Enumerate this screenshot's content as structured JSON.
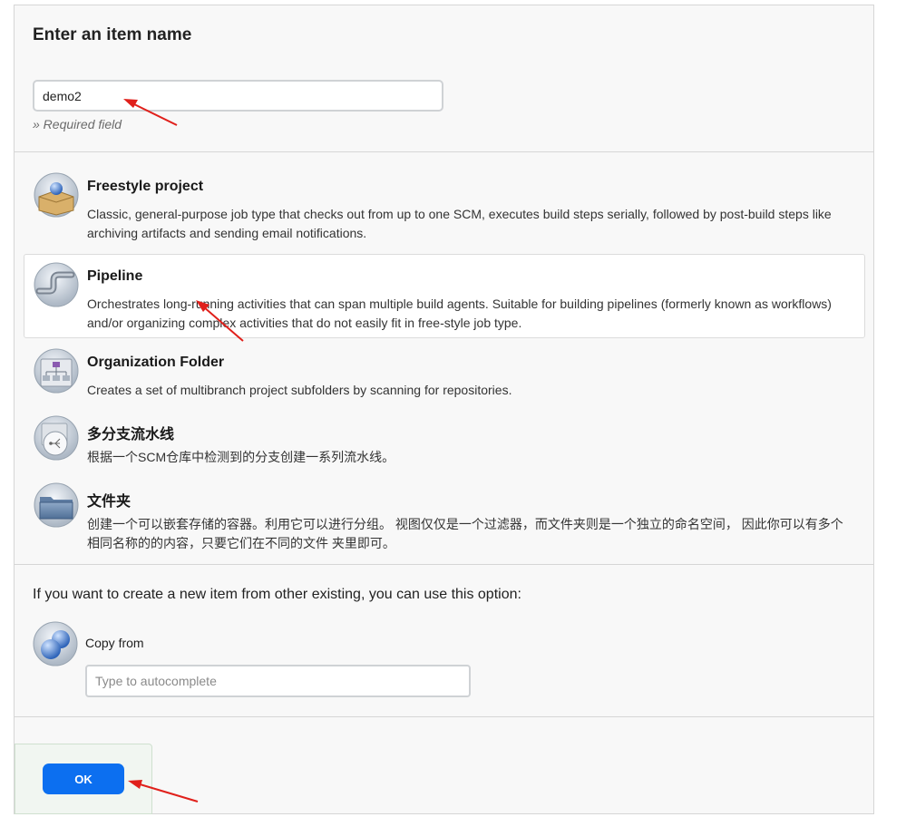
{
  "name_section": {
    "heading": "Enter an item name",
    "input_value": "demo2",
    "required_note": "» Required field"
  },
  "item_types": [
    {
      "icon": "freestyle-project-icon",
      "label": "Freestyle project",
      "description": "Classic, general-purpose job type that checks out from up to one SCM, executes build steps serially, followed by post-build steps like archiving artifacts and sending email notifications.",
      "selected": false
    },
    {
      "icon": "pipeline-icon",
      "label": "Pipeline",
      "description": "Orchestrates long-running activities that can span multiple build agents. Suitable for building pipelines (formerly known as workflows) and/or organizing complex activities that do not easily fit in free-style job type.",
      "selected": true
    },
    {
      "icon": "organization-folder-icon",
      "label": "Organization Folder",
      "description": "Creates a set of multibranch project subfolders by scanning for repositories.",
      "selected": false
    },
    {
      "icon": "multibranch-pipeline-icon",
      "label": "多分支流水线",
      "description": "根据一个SCM仓库中检测到的分支创建一系列流水线。",
      "selected": false
    },
    {
      "icon": "folder-icon",
      "label": "文件夹",
      "description": "创建一个可以嵌套存储的容器。利用它可以进行分组。 视图仅仅是一个过滤器，而文件夹则是一个独立的命名空间， 因此你可以有多个相同名称的的内容，只要它们在不同的文件 夹里即可。",
      "selected": false
    }
  ],
  "copy_section": {
    "intro": "If you want to create a new item from other existing, you can use this option:",
    "label": "Copy from",
    "placeholder": "Type to autocomplete",
    "icon": "copy-from-icon"
  },
  "ok_button": {
    "label": "OK"
  },
  "annotation_color": "#e0201b"
}
